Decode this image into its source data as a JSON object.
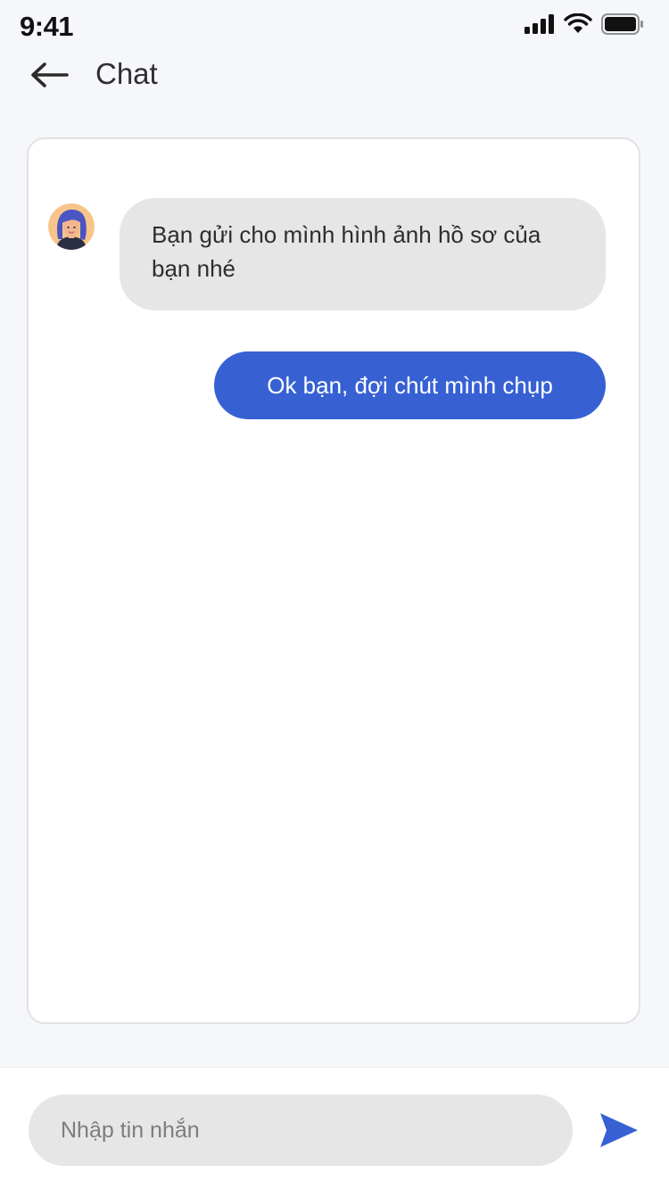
{
  "status_bar": {
    "time": "9:41",
    "icons": [
      "signal-icon",
      "wifi-icon",
      "battery-icon"
    ]
  },
  "header": {
    "title": "Chat",
    "back_icon": "arrow-left-icon"
  },
  "messages": [
    {
      "direction": "received",
      "text": "Bạn gửi cho mình hình ảnh hồ sơ của bạn nhé",
      "avatar": "avatar-icon"
    },
    {
      "direction": "sent",
      "text": "Ok bạn, đợi chút mình chụp"
    }
  ],
  "composer": {
    "placeholder": "Nhập tin nhắn",
    "value": "",
    "send_icon": "send-icon"
  },
  "colors": {
    "accent": "#3761d3",
    "received_bubble": "#e6e6e6",
    "page_background": "#f6f7fb",
    "card_background": "#ffffff"
  }
}
